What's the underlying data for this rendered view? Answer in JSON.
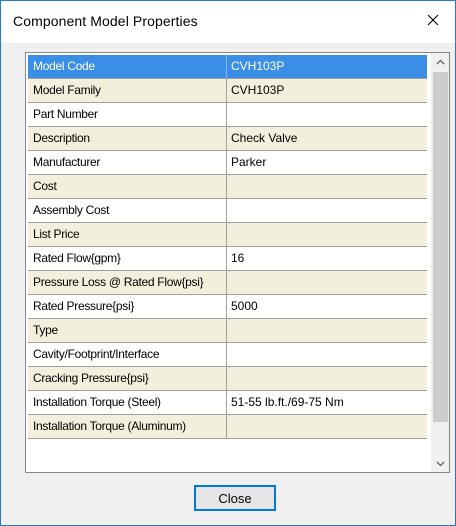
{
  "dialog": {
    "title": "Component Model Properties",
    "close_glyph": "×",
    "close_button_label": "Close"
  },
  "colors": {
    "selected_row": "#3a8ee6",
    "alt_row": "#f2f0dc",
    "plain_row": "#ffffff",
    "grid_line": "#a0a0a0",
    "window_border": "#2b79c2"
  },
  "icons": {
    "scroll_up": "chevron-up-icon",
    "scroll_down": "chevron-down-icon",
    "close": "close-icon"
  },
  "properties": [
    {
      "name": "Model Code",
      "value": "CVH103P",
      "style": "sel"
    },
    {
      "name": "Model Family",
      "value": "CVH103P",
      "style": "alt"
    },
    {
      "name": "Part Number",
      "value": "",
      "style": "plain"
    },
    {
      "name": "Description",
      "value": "Check Valve",
      "style": "alt"
    },
    {
      "name": "Manufacturer",
      "value": "Parker",
      "style": "plain"
    },
    {
      "name": "Cost",
      "value": "",
      "style": "alt"
    },
    {
      "name": "Assembly Cost",
      "value": "",
      "style": "plain"
    },
    {
      "name": "List Price",
      "value": "",
      "style": "alt"
    },
    {
      "name": "Rated Flow{gpm}",
      "value": "16",
      "style": "plain"
    },
    {
      "name": "Pressure Loss @ Rated Flow{psi}",
      "value": "",
      "style": "alt"
    },
    {
      "name": "Rated Pressure{psi}",
      "value": "5000",
      "style": "plain"
    },
    {
      "name": "Type",
      "value": "",
      "style": "alt"
    },
    {
      "name": "Cavity/Footprint/Interface",
      "value": "",
      "style": "plain"
    },
    {
      "name": "Cracking Pressure{psi}",
      "value": "",
      "style": "alt"
    },
    {
      "name": "Installation Torque (Steel)",
      "value": "51-55 lb.ft./69-75 Nm",
      "style": "plain"
    },
    {
      "name": "Installation Torque (Aluminum)",
      "value": "",
      "style": "alt"
    }
  ]
}
